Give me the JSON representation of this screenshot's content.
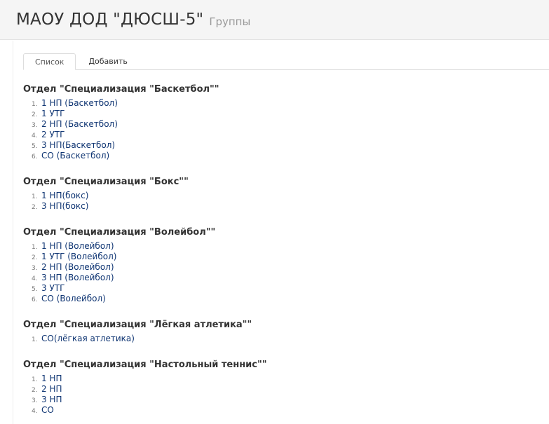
{
  "header": {
    "title": "МАОУ ДОД \"ДЮСШ-5\"",
    "subtitle": "Группы"
  },
  "tabs": [
    {
      "label": "Список",
      "active": true
    },
    {
      "label": "Добавить",
      "active": false
    }
  ],
  "departments": [
    {
      "title": "Отдел \"Специализация \"Баскетбол\"\"",
      "groups": [
        {
          "num": "1.",
          "label": "1 НП (Баскетбол)"
        },
        {
          "num": "2.",
          "label": "1 УТГ"
        },
        {
          "num": "3.",
          "label": "2 НП (Баскетбол)"
        },
        {
          "num": "4.",
          "label": "2 УТГ"
        },
        {
          "num": "5.",
          "label": "3 НП(Баскетбол)"
        },
        {
          "num": "6.",
          "label": "СО (Баскетбол)"
        }
      ]
    },
    {
      "title": "Отдел \"Специализация \"Бокс\"\"",
      "groups": [
        {
          "num": "1.",
          "label": "1 НП(бокс)"
        },
        {
          "num": "2.",
          "label": "3 НП(бокс)"
        }
      ]
    },
    {
      "title": "Отдел \"Специализация \"Волейбол\"\"",
      "groups": [
        {
          "num": "1.",
          "label": "1 НП (Волейбол)"
        },
        {
          "num": "2.",
          "label": "1 УТГ (Волейбол)"
        },
        {
          "num": "3.",
          "label": "2 НП (Волейбол)"
        },
        {
          "num": "4.",
          "label": "3 НП (Волейбол)"
        },
        {
          "num": "5.",
          "label": "3 УТГ"
        },
        {
          "num": "6.",
          "label": "СО (Волейбол)"
        }
      ]
    },
    {
      "title": "Отдел \"Специализация \"Лёгкая атлетика\"\"",
      "groups": [
        {
          "num": "1.",
          "label": "СО(лёгкая атлетика)"
        }
      ]
    },
    {
      "title": "Отдел \"Специализация \"Настольный теннис\"\"",
      "groups": [
        {
          "num": "1.",
          "label": "1 НП"
        },
        {
          "num": "2.",
          "label": "2 НП"
        },
        {
          "num": "3.",
          "label": "3 НП"
        },
        {
          "num": "4.",
          "label": "СО"
        }
      ]
    }
  ]
}
